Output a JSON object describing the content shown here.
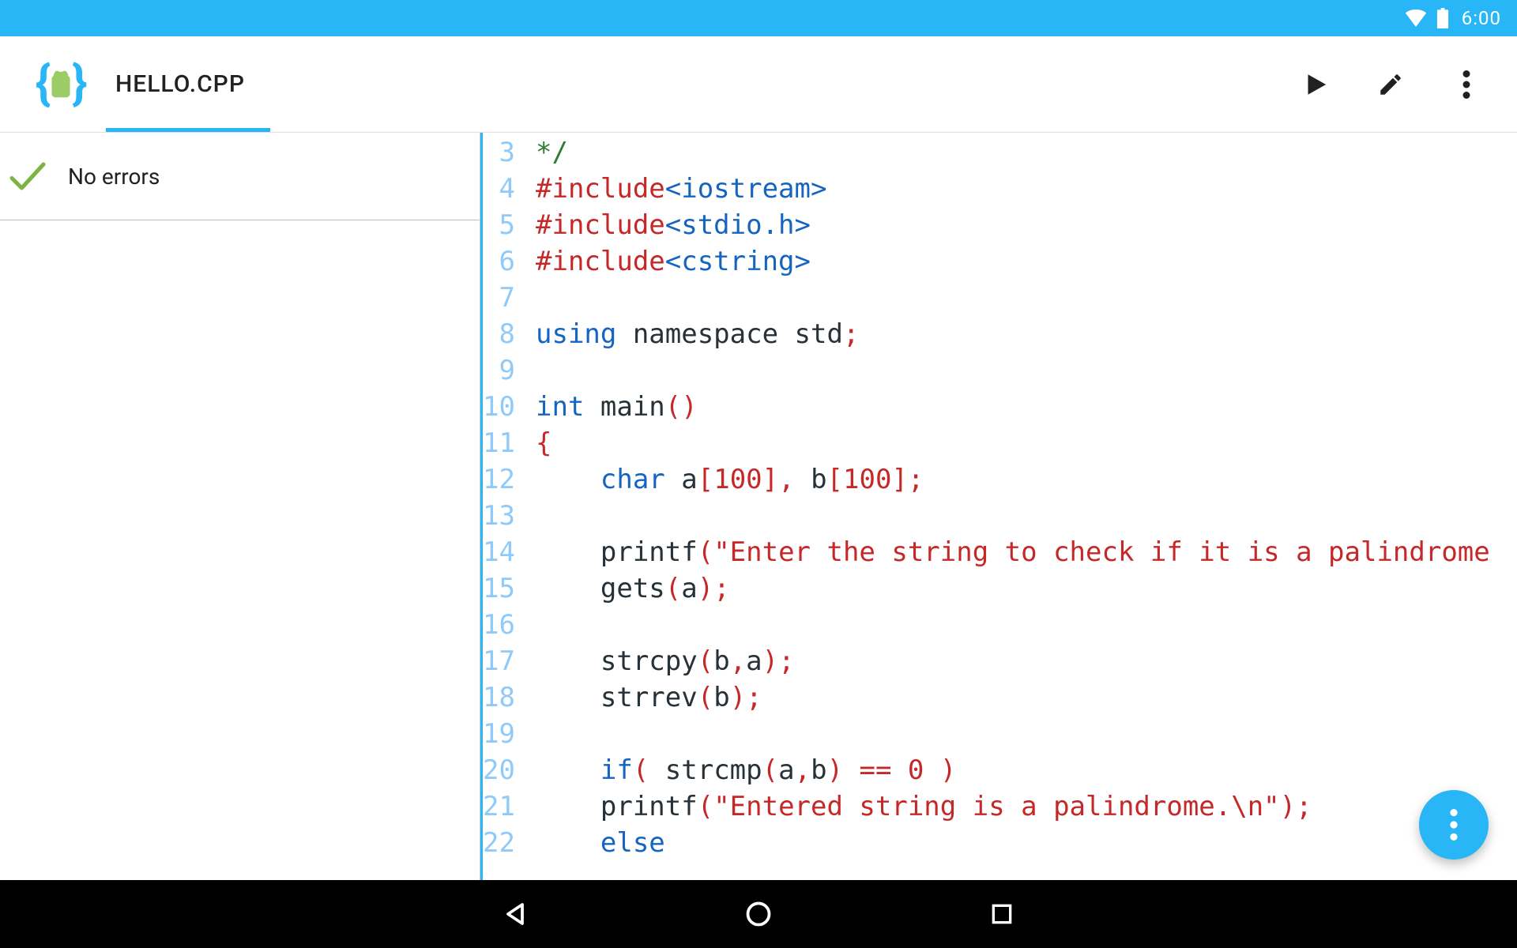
{
  "status_bar": {
    "time": "6:00"
  },
  "app_bar": {
    "title": "HELLO.CPP"
  },
  "sidebar": {
    "status_text": "No errors"
  },
  "colors": {
    "accent": "#29b6f6",
    "gutter_text": "#90caf9",
    "keyword": "#1565c0",
    "operator_string": "#c62828",
    "comment": "#2e7d32",
    "text": "#263238"
  },
  "gutter_start": 3,
  "gutter_end": 22,
  "code_lines": [
    {
      "n": 3,
      "tokens": [
        {
          "t": "*/",
          "c": "green"
        }
      ]
    },
    {
      "n": 4,
      "tokens": [
        {
          "t": "#include",
          "c": "pp"
        },
        {
          "t": "<iostream>",
          "c": "hdr"
        }
      ]
    },
    {
      "n": 5,
      "tokens": [
        {
          "t": "#include",
          "c": "pp"
        },
        {
          "t": "<stdio.h>",
          "c": "hdr"
        }
      ]
    },
    {
      "n": 6,
      "tokens": [
        {
          "t": "#include",
          "c": "pp"
        },
        {
          "t": "<cstring>",
          "c": "hdr"
        }
      ]
    },
    {
      "n": 7,
      "tokens": []
    },
    {
      "n": 8,
      "tokens": [
        {
          "t": "using ",
          "c": "kw"
        },
        {
          "t": "namespace ",
          "c": "id"
        },
        {
          "t": "std",
          "c": "id"
        },
        {
          "t": ";",
          "c": "punc"
        }
      ]
    },
    {
      "n": 9,
      "tokens": []
    },
    {
      "n": 10,
      "tokens": [
        {
          "t": "int ",
          "c": "kw"
        },
        {
          "t": "main",
          "c": "id"
        },
        {
          "t": "()",
          "c": "punc"
        }
      ]
    },
    {
      "n": 11,
      "tokens": [
        {
          "t": "{",
          "c": "punc"
        }
      ]
    },
    {
      "n": 12,
      "tokens": [
        {
          "t": "    ",
          "c": "id"
        },
        {
          "t": "char ",
          "c": "kw"
        },
        {
          "t": "a",
          "c": "id"
        },
        {
          "t": "[",
          "c": "punc"
        },
        {
          "t": "100",
          "c": "num"
        },
        {
          "t": "], ",
          "c": "punc"
        },
        {
          "t": "b",
          "c": "id"
        },
        {
          "t": "[",
          "c": "punc"
        },
        {
          "t": "100",
          "c": "num"
        },
        {
          "t": "];",
          "c": "punc"
        }
      ]
    },
    {
      "n": 13,
      "tokens": []
    },
    {
      "n": 14,
      "tokens": [
        {
          "t": "    ",
          "c": "id"
        },
        {
          "t": "printf",
          "c": "id"
        },
        {
          "t": "(",
          "c": "punc"
        },
        {
          "t": "\"Enter the string to check if it is a palindrome",
          "c": "str"
        }
      ]
    },
    {
      "n": 15,
      "tokens": [
        {
          "t": "    ",
          "c": "id"
        },
        {
          "t": "gets",
          "c": "id"
        },
        {
          "t": "(",
          "c": "punc"
        },
        {
          "t": "a",
          "c": "id"
        },
        {
          "t": ");",
          "c": "punc"
        }
      ]
    },
    {
      "n": 16,
      "tokens": []
    },
    {
      "n": 17,
      "tokens": [
        {
          "t": "    ",
          "c": "id"
        },
        {
          "t": "strcpy",
          "c": "id"
        },
        {
          "t": "(",
          "c": "punc"
        },
        {
          "t": "b",
          "c": "id"
        },
        {
          "t": ",",
          "c": "punc"
        },
        {
          "t": "a",
          "c": "id"
        },
        {
          "t": ");",
          "c": "punc"
        }
      ]
    },
    {
      "n": 18,
      "tokens": [
        {
          "t": "    ",
          "c": "id"
        },
        {
          "t": "strrev",
          "c": "id"
        },
        {
          "t": "(",
          "c": "punc"
        },
        {
          "t": "b",
          "c": "id"
        },
        {
          "t": ");",
          "c": "punc"
        }
      ]
    },
    {
      "n": 19,
      "tokens": []
    },
    {
      "n": 20,
      "tokens": [
        {
          "t": "    ",
          "c": "id"
        },
        {
          "t": "if",
          "c": "kw"
        },
        {
          "t": "( ",
          "c": "punc"
        },
        {
          "t": "strcmp",
          "c": "id"
        },
        {
          "t": "(",
          "c": "punc"
        },
        {
          "t": "a",
          "c": "id"
        },
        {
          "t": ",",
          "c": "punc"
        },
        {
          "t": "b",
          "c": "id"
        },
        {
          "t": ") == ",
          "c": "punc"
        },
        {
          "t": "0",
          "c": "num"
        },
        {
          "t": " )",
          "c": "punc"
        }
      ]
    },
    {
      "n": 21,
      "tokens": [
        {
          "t": "    ",
          "c": "id"
        },
        {
          "t": "printf",
          "c": "id"
        },
        {
          "t": "(",
          "c": "punc"
        },
        {
          "t": "\"Entered string is a palindrome.\\n\"",
          "c": "str"
        },
        {
          "t": ");",
          "c": "punc"
        }
      ]
    },
    {
      "n": 22,
      "tokens": [
        {
          "t": "    ",
          "c": "id"
        },
        {
          "t": "else",
          "c": "kw"
        }
      ]
    }
  ]
}
